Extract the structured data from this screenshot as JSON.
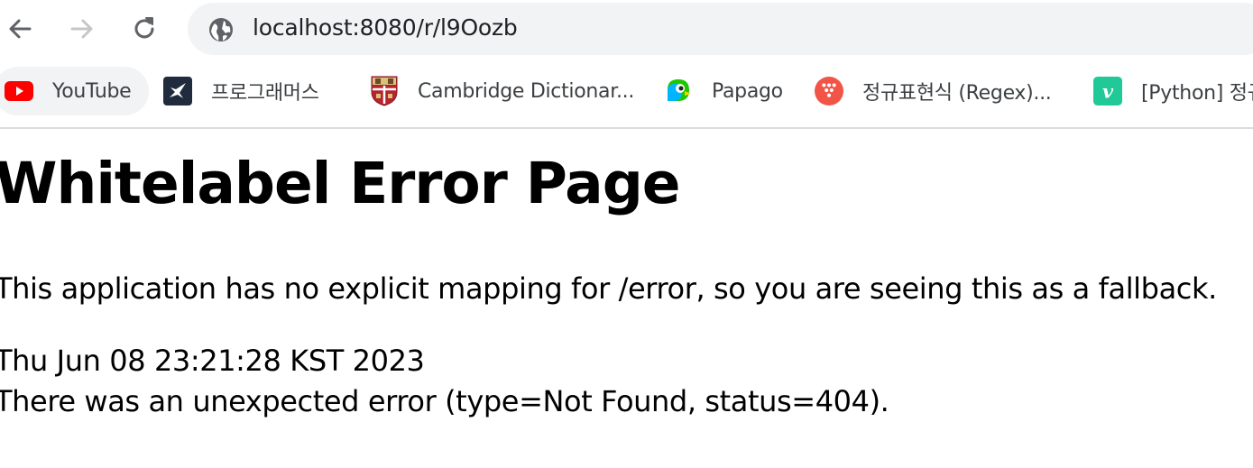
{
  "browser": {
    "url": "localhost:8080/r/l9Oozb",
    "bookmarks": [
      {
        "label": "YouTube",
        "icon": "youtube-icon",
        "color": "#ff0000"
      },
      {
        "label": "프로그래머스",
        "icon": "programmers-icon",
        "color": "#202b3d"
      },
      {
        "label": "Cambridge Dictionar...",
        "icon": "cambridge-crest-icon",
        "color": "#b5242f"
      },
      {
        "label": "Papago",
        "icon": "papago-icon",
        "color": "#1ec800"
      },
      {
        "label": "정규표현식 (Regex)...",
        "icon": "regex-dots-icon",
        "color": "#f25548"
      },
      {
        "label": "[Python] 정규",
        "icon": "velog-v-icon",
        "color": "#20c997"
      }
    ]
  },
  "page": {
    "title": "Whitelabel Error Page",
    "description": "This application has no explicit mapping for /error, so you are seeing this as a fallback.",
    "timestamp": "Thu Jun 08 23:21:28 KST 2023",
    "error": "There was an unexpected error (type=Not Found, status=404)."
  }
}
